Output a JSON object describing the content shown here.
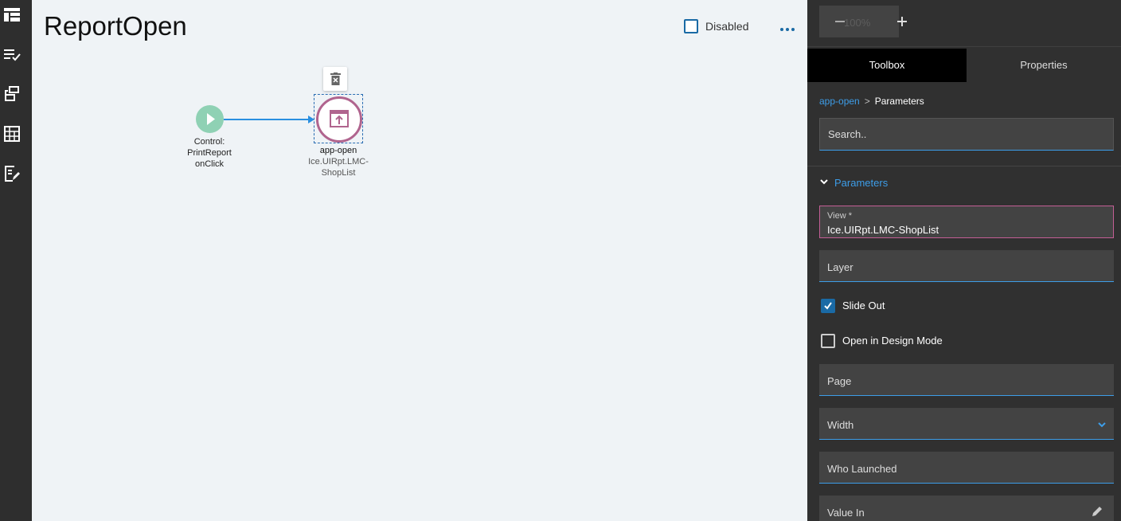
{
  "canvas": {
    "title": "ReportOpen",
    "disabled_label": "Disabled",
    "nodes": {
      "start": {
        "line1": "Control:",
        "line2": "PrintReport",
        "line3": "onClick"
      },
      "app": {
        "line1": "app-open",
        "line2": "Ice.UIRpt.LMC-",
        "line3": "ShopList"
      }
    }
  },
  "zoom": {
    "level": "100%"
  },
  "tabs": {
    "toolbox": "Toolbox",
    "properties": "Properties"
  },
  "breadcrumb": {
    "link": "app-open",
    "separator": ">",
    "current": "Parameters"
  },
  "search": {
    "placeholder": "Search.."
  },
  "section": {
    "title": "Parameters"
  },
  "params": {
    "view_label": "View *",
    "view_value": "Ice.UIRpt.LMC-ShopList",
    "layer": "Layer",
    "slide_out": "Slide Out",
    "open_design": "Open in Design Mode",
    "page": "Page",
    "width": "Width",
    "who_launched": "Who Launched",
    "value_in": "Value In"
  },
  "colors": {
    "accent": "#3d9de8",
    "node_app": "#b0648e",
    "node_start": "#8fd1b4"
  }
}
